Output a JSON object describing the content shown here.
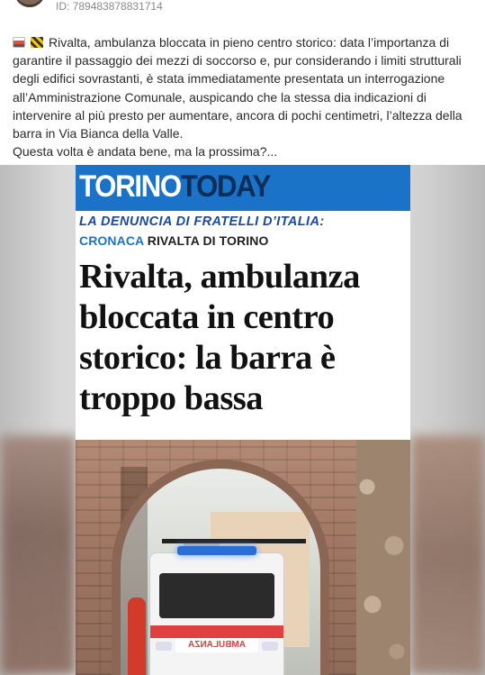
{
  "post": {
    "id": "ID: 789483878831714",
    "emoji_1": "ambulance",
    "emoji_2": "construction-barrier",
    "text_line_main": "Rivalta, ambulanza bloccata in pieno centro storico: data l’importanza di garantire il passaggio dei mezzi di soccorso e, pur considerando i limiti strutturali degli edifici sovrastanti, è stata immediatamente presentata un interrogazione all’Amministrazione Comunale, auspicando che la stessa dia indicazioni di intervenire al più presto per aumentare, ancora di pochi centimetri, l’altezza della barra in Via Bianca della Valle.",
    "text_line_2": "Questa volta è andata bene, ma la prossima?..."
  },
  "article": {
    "brand_torino": "TORINO",
    "brand_today": "TODAY",
    "kicker": "LA DENUNCIA DI FRATELLI D’ITALIA:",
    "category": "CRONACA",
    "location": "RIVALTA DI TORINO",
    "headline": "Rivalta, ambulanza bloccata in centro storico: la barra è troppo bassa",
    "ambulance_label": "AMBULANZA"
  },
  "colors": {
    "brand_blue": "#1a73c7",
    "kicker_blue": "#1a4b9a",
    "id_gray": "#8a8a8a"
  }
}
